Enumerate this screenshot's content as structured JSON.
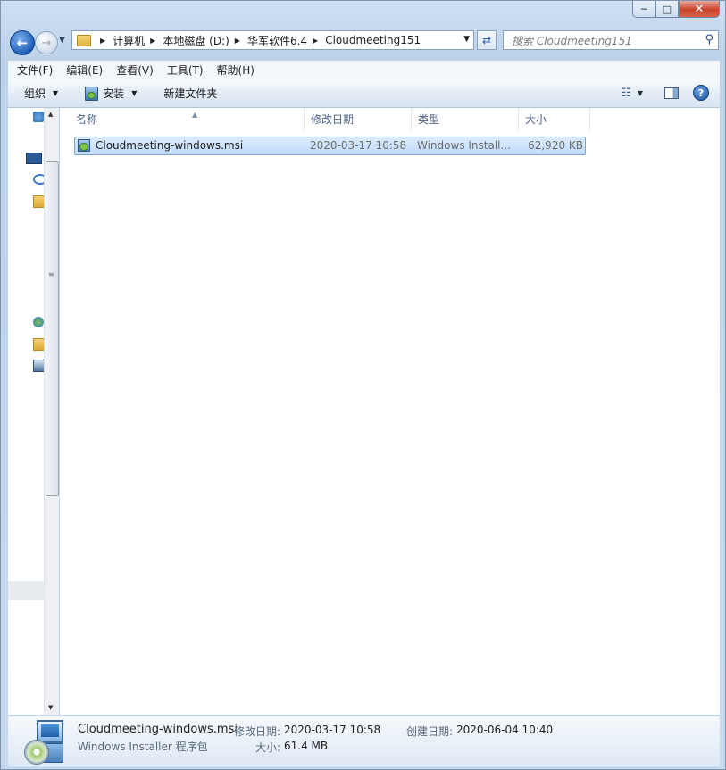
{
  "window": {
    "caption_buttons": {
      "minimize": "─",
      "maximize": "□",
      "close": "✕"
    }
  },
  "nav": {
    "back_icon": "back-arrow-icon",
    "forward_icon": "forward-arrow-icon",
    "breadcrumbs": [
      "计算机",
      "本地磁盘 (D:)",
      "华军软件6.4",
      "Cloudmeeting151"
    ],
    "search_placeholder": "搜索 Cloudmeeting151"
  },
  "menubar": {
    "items": [
      "文件(F)",
      "编辑(E)",
      "查看(V)",
      "工具(T)",
      "帮助(H)"
    ]
  },
  "toolbar": {
    "organize": "组织",
    "install": "安装",
    "new_folder": "新建文件夹"
  },
  "columns": {
    "name": "名称",
    "date": "修改日期",
    "type": "类型",
    "size": "大小"
  },
  "files": [
    {
      "name": "Cloudmeeting-windows.msi",
      "date": "2020-03-17 10:58",
      "type": "Windows Install...",
      "size": "62,920 KB",
      "selected": true
    }
  ],
  "details": {
    "name": "Cloudmeeting-windows.msi",
    "type": "Windows Installer 程序包",
    "modified_label": "修改日期:",
    "modified_value": "2020-03-17 10:58",
    "created_label": "创建日期:",
    "created_value": "2020-06-04 10:40",
    "size_label": "大小:",
    "size_value": "61.4 MB"
  },
  "colors": {
    "selection": "#cce4fb",
    "selection_border": "#7da2ce",
    "header_text": "#4d6185"
  }
}
